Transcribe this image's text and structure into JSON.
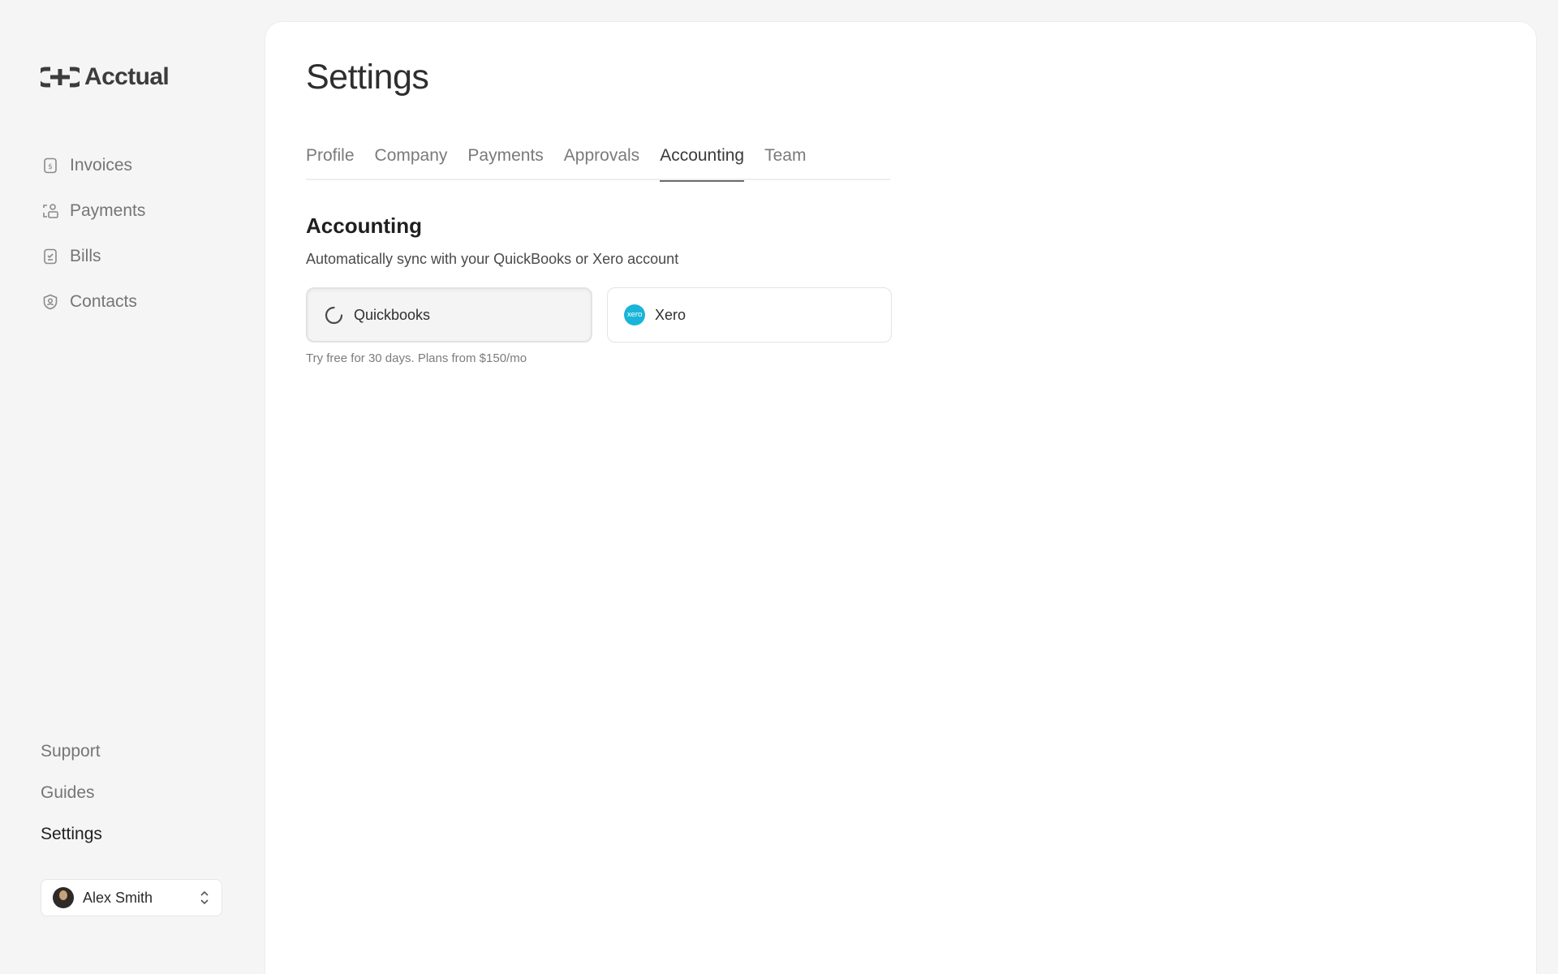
{
  "brand": {
    "name": "Acctual"
  },
  "sidebar": {
    "items": [
      {
        "label": "Invoices",
        "icon": "invoice-icon"
      },
      {
        "label": "Payments",
        "icon": "payments-icon"
      },
      {
        "label": "Bills",
        "icon": "bills-icon"
      },
      {
        "label": "Contacts",
        "icon": "contacts-icon"
      }
    ],
    "bottom": [
      {
        "label": "Support"
      },
      {
        "label": "Guides"
      },
      {
        "label": "Settings",
        "active": true
      }
    ],
    "user": {
      "name": "Alex Smith"
    }
  },
  "main": {
    "title": "Settings",
    "tabs": [
      {
        "label": "Profile"
      },
      {
        "label": "Company"
      },
      {
        "label": "Payments"
      },
      {
        "label": "Approvals"
      },
      {
        "label": "Accounting",
        "active": true
      },
      {
        "label": "Team"
      }
    ],
    "section": {
      "title": "Accounting",
      "description": "Automatically sync with your QuickBooks or Xero account",
      "providers": [
        {
          "label": "Quickbooks",
          "icon": "loading-spinner-icon"
        },
        {
          "label": "Xero",
          "icon": "xero-logo-icon",
          "logo_text": "xero"
        }
      ],
      "hint": "Try free for 30 days. Plans from $150/mo"
    }
  },
  "colors": {
    "background": "#f5f5f5",
    "panel": "#ffffff",
    "xero": "#19b5d8",
    "muted_text": "#757575"
  }
}
